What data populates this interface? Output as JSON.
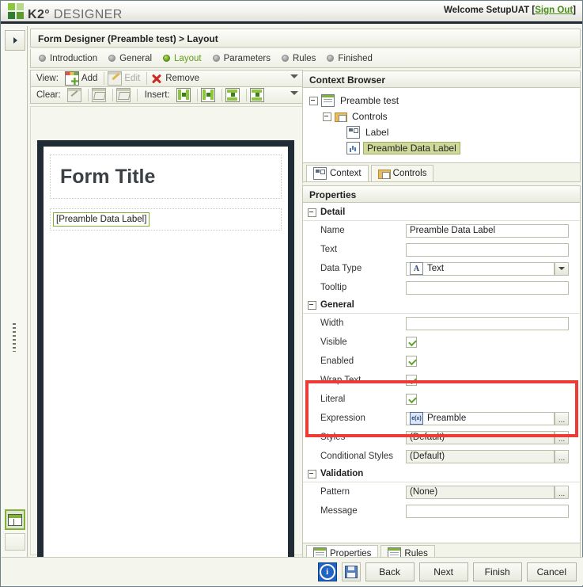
{
  "header": {
    "logo_text_bold": "K2",
    "logo_text_sup": "°",
    "logo_text_light": " DESIGNER",
    "welcome_prefix": "Welcome SetupUAT [",
    "sign_out": "Sign Out",
    "welcome_suffix": "]"
  },
  "designer": {
    "title": "Form Designer (Preamble test) > Layout",
    "steps": [
      {
        "label": "Introduction",
        "active": false
      },
      {
        "label": "General",
        "active": false
      },
      {
        "label": "Layout",
        "active": true
      },
      {
        "label": "Parameters",
        "active": false
      },
      {
        "label": "Rules",
        "active": false
      },
      {
        "label": "Finished",
        "active": false
      }
    ]
  },
  "toolbar": {
    "view_label": "View:",
    "add_label": "Add",
    "edit_label": "Edit",
    "remove_label": "Remove",
    "clear_label": "Clear:",
    "insert_label": "Insert:"
  },
  "canvas": {
    "form_title": "Form Title",
    "label_placeholder": "[Preamble Data Label]"
  },
  "context_browser": {
    "title": "Context Browser",
    "tree": [
      {
        "label": "Preamble test"
      },
      {
        "label": "Controls"
      },
      {
        "label": "Label"
      },
      {
        "label": "Preamble Data Label"
      }
    ],
    "tabs": [
      {
        "label": "Context",
        "active": true
      },
      {
        "label": "Controls",
        "active": false
      }
    ]
  },
  "properties": {
    "title": "Properties",
    "groups": {
      "detail": "Detail",
      "general": "General",
      "validation": "Validation"
    },
    "fields": {
      "name_label": "Name",
      "name_value": "Preamble Data Label",
      "text_label": "Text",
      "text_value": "",
      "datatype_label": "Data Type",
      "datatype_value": "Text",
      "datatype_icon": "A",
      "tooltip_label": "Tooltip",
      "tooltip_value": "",
      "width_label": "Width",
      "width_value": "",
      "visible_label": "Visible",
      "enabled_label": "Enabled",
      "wraptext_label": "Wrap Text",
      "literal_label": "Literal",
      "expression_label": "Expression",
      "expression_value": "Preamble",
      "expression_icon": "e(x)",
      "styles_label": "Styles",
      "styles_value": "(Default)",
      "condstyles_label": "Conditional Styles",
      "condstyles_value": "(Default)",
      "pattern_label": "Pattern",
      "pattern_value": "(None)",
      "message_label": "Message",
      "message_value": "",
      "ellipsis": "..."
    },
    "tabs": [
      {
        "label": "Properties",
        "active": true
      },
      {
        "label": "Rules",
        "active": false
      }
    ]
  },
  "footer": {
    "back": "Back",
    "next": "Next",
    "finish": "Finish",
    "cancel": "Cancel",
    "info_glyph": "i"
  },
  "colors": {
    "accent_green": "#5f9d16",
    "highlight_red": "#ef3b36",
    "selection_green": "#7fb236",
    "canvas_dark": "#1f2c36"
  }
}
